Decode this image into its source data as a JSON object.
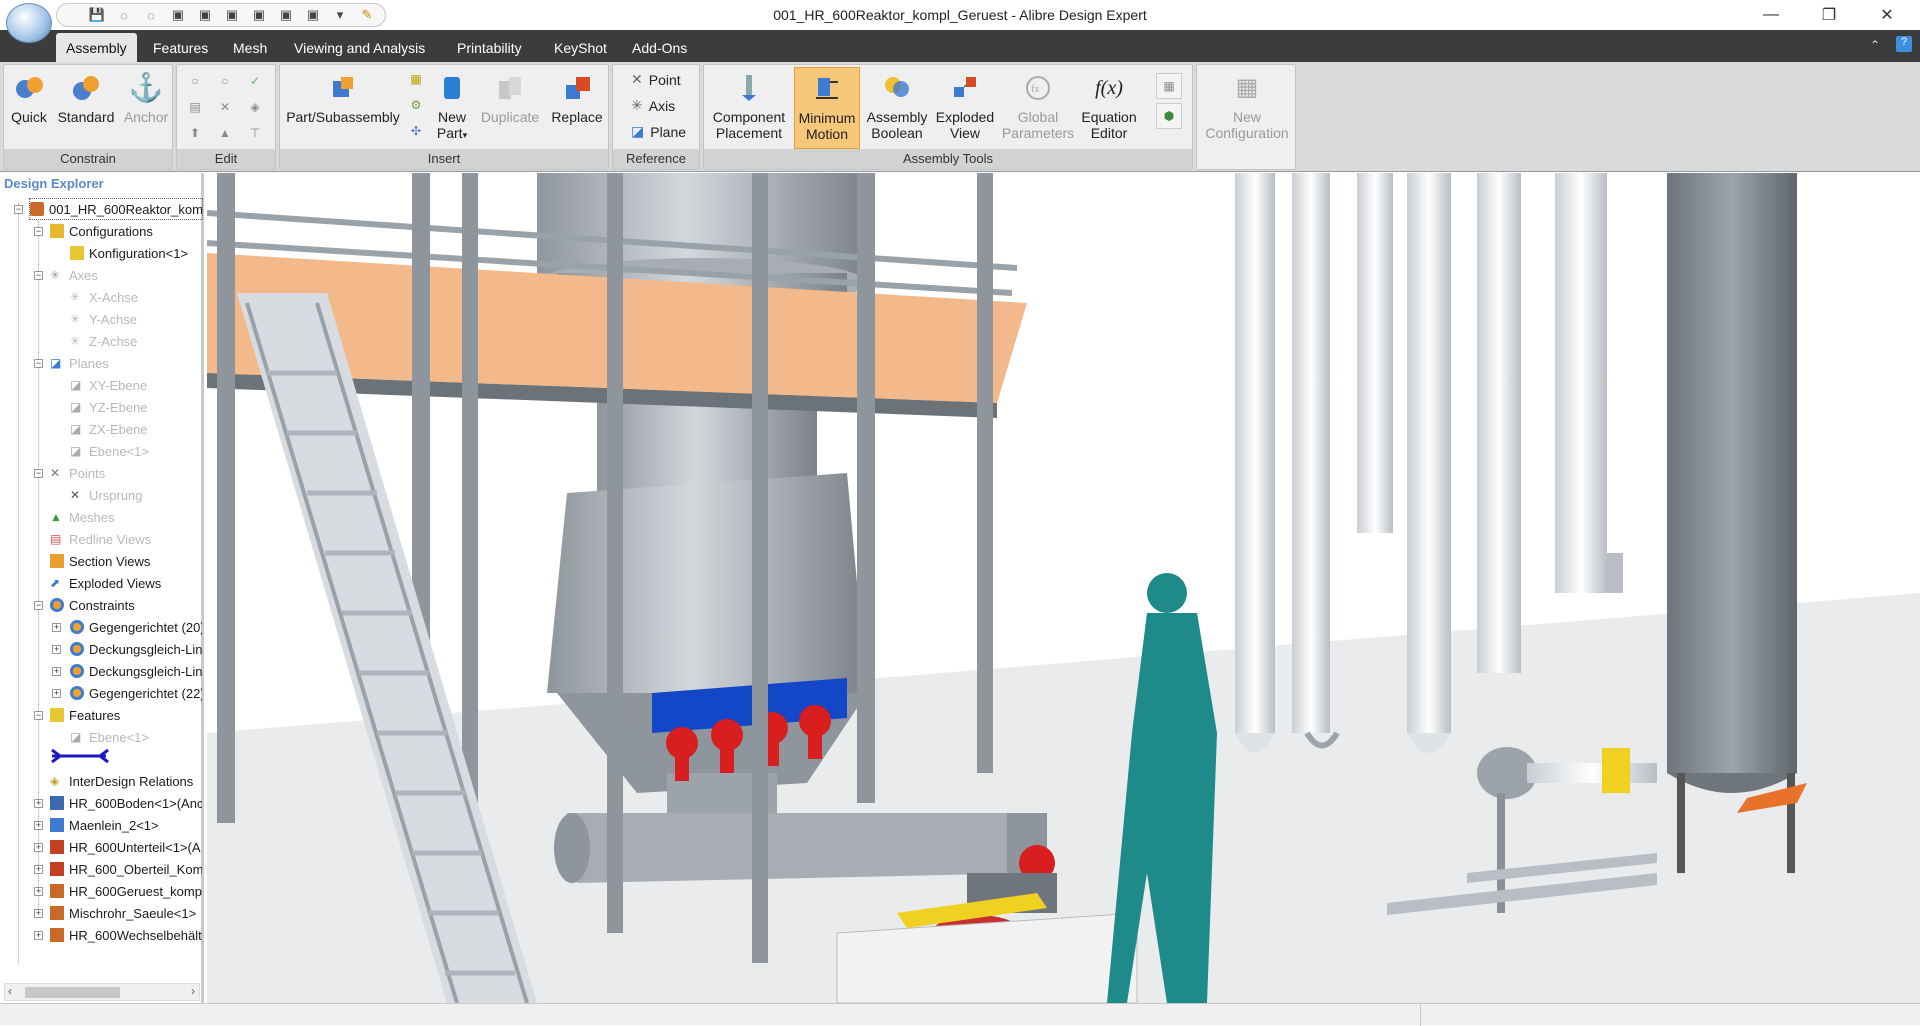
{
  "window": {
    "title": "001_HR_600Reaktor_kompl_Geruest - Alibre Design Expert",
    "minimize": "—",
    "restore": "❐",
    "close": "✕"
  },
  "tabs": [
    "Assembly",
    "Features",
    "Mesh",
    "Viewing and Analysis",
    "Printability",
    "KeyShot",
    "Add-Ons"
  ],
  "ribbon": {
    "constrain": {
      "label": "Constrain",
      "quick": "Quick",
      "standard": "Standard",
      "anchor": "Anchor"
    },
    "edit": {
      "label": "Edit"
    },
    "insert": {
      "label": "Insert",
      "part_subassembly": "Part/Subassembly",
      "new": "New",
      "part": "Part",
      "duplicate": "Duplicate",
      "replace": "Replace"
    },
    "reference": {
      "label": "Reference",
      "point": "Point",
      "axis": "Axis",
      "plane": "Plane"
    },
    "assembly_tools": {
      "label": "Assembly Tools",
      "component": "Component",
      "placement": "Placement",
      "minimum": "Minimum",
      "motion": "Motion",
      "assembly": "Assembly",
      "boolean": "Boolean",
      "exploded": "Exploded",
      "view": "View",
      "global": "Global",
      "parameters": "Parameters",
      "equation": "Equation",
      "editor": "Editor",
      "fx": "f(x)"
    },
    "config": {
      "new": "New",
      "configuration": "Configuration"
    }
  },
  "explorer": {
    "title": "Design Explorer",
    "nodes": {
      "root": "001_HR_600Reaktor_kom",
      "configurations": "Configurations",
      "konfiguration": "Konfiguration<1>",
      "axes": "Axes",
      "x_achse": "X-Achse",
      "y_achse": "Y-Achse",
      "z_achse": "Z-Achse",
      "planes": "Planes",
      "xy_ebene": "XY-Ebene",
      "yz_ebene": "YZ-Ebene",
      "zx_ebene": "ZX-Ebene",
      "ebene1": "Ebene<1>",
      "points": "Points",
      "ursprung": "Ursprung",
      "meshes": "Meshes",
      "redline": "Redline Views",
      "section": "Section Views",
      "exploded": "Exploded Views",
      "constraints": "Constraints",
      "c1": "Gegengerichtet (20)",
      "c2": "Deckungsgleich-Lin",
      "c3": "Deckungsgleich-Lin",
      "c4": "Gegengerichtet (22)",
      "features": "Features",
      "f_ebene": "Ebene<1>",
      "interdesign": "InterDesign Relations",
      "p1": "HR_600Boden<1>(Anc",
      "p2": "Maenlein_2<1>",
      "p3": "HR_600Unterteil<1>(A",
      "p4": "HR_600_Oberteil_Kom",
      "p5": "HR_600Geruest_komp",
      "p6": "Mischrohr_Saeule<1>",
      "p7": "HR_600Wechselbehält"
    }
  },
  "colors": {
    "tabbar": "#3c3c3c",
    "ribbon": "#d9dadb",
    "pressed": "#f7c77a",
    "platform": "#f4b98a",
    "steel": "#a9b0b8",
    "teal": "#1f8a8a",
    "red": "#d81e1e",
    "blue": "#1446c8"
  }
}
